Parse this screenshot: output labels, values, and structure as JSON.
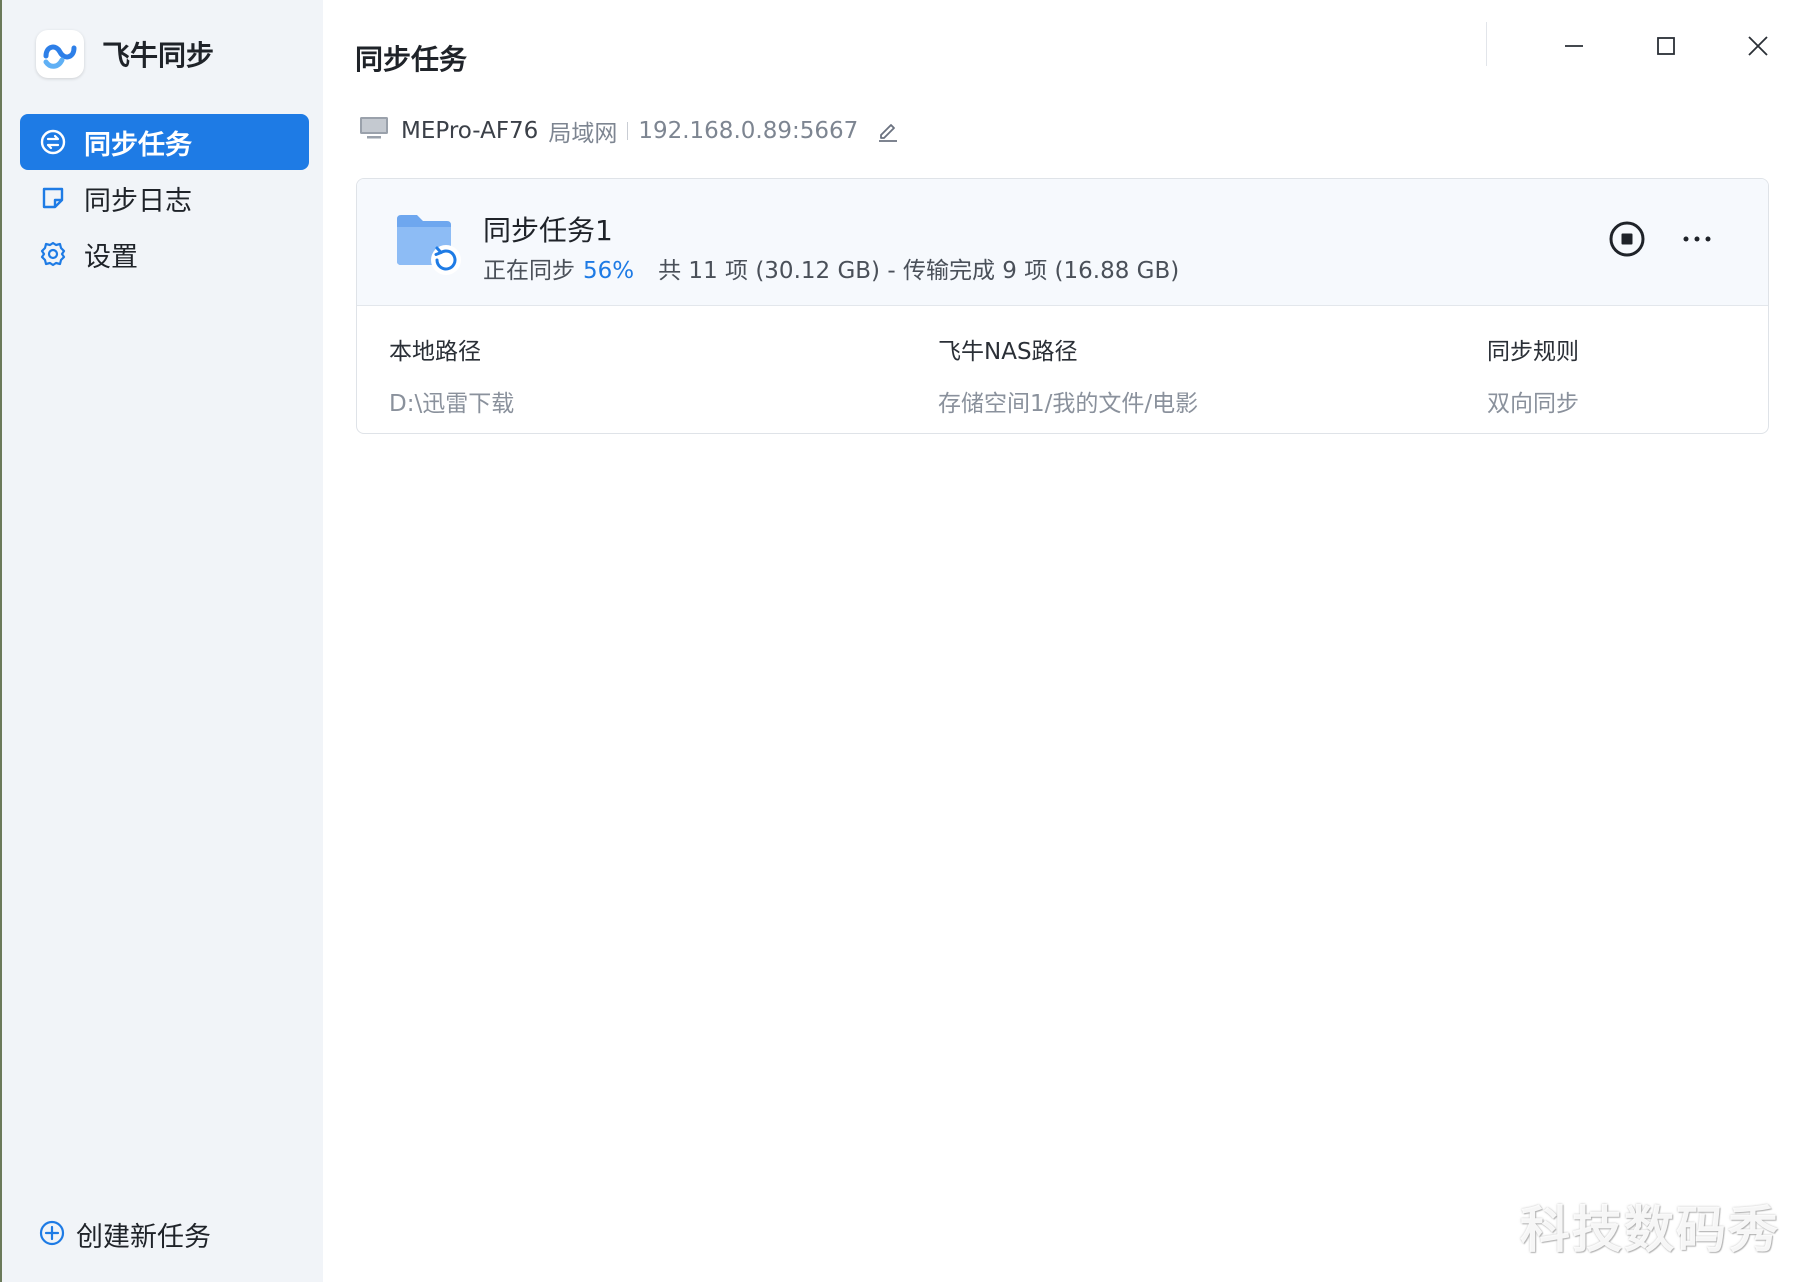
{
  "app": {
    "name": "飞牛同步"
  },
  "sidebar": {
    "items": [
      {
        "label": "同步任务",
        "icon": "sync-icon",
        "active": true
      },
      {
        "label": "同步日志",
        "icon": "log-icon",
        "active": false
      },
      {
        "label": "设置",
        "icon": "gear-icon",
        "active": false
      }
    ],
    "create_label": "创建新任务"
  },
  "main": {
    "title": "同步任务",
    "device": {
      "name": "MEPro-AF76",
      "network": "局域网",
      "address": "192.168.0.89:5667"
    },
    "task": {
      "name": "同步任务1",
      "status": "正在同步",
      "progress": "56%",
      "summary": "共 11 项 (30.12 GB) - 传输完成 9 项 (16.88 GB)",
      "local_label": "本地路径",
      "local_value": "D:\\迅雷下载",
      "nas_label": "飞牛NAS路径",
      "nas_value": "存储空间1/我的文件/电影",
      "rule_label": "同步规则",
      "rule_value": "双向同步"
    }
  },
  "watermark": "科技数码秀",
  "colors": {
    "accent": "#1e7be5",
    "sidebar_bg": "#f1f4f8"
  }
}
